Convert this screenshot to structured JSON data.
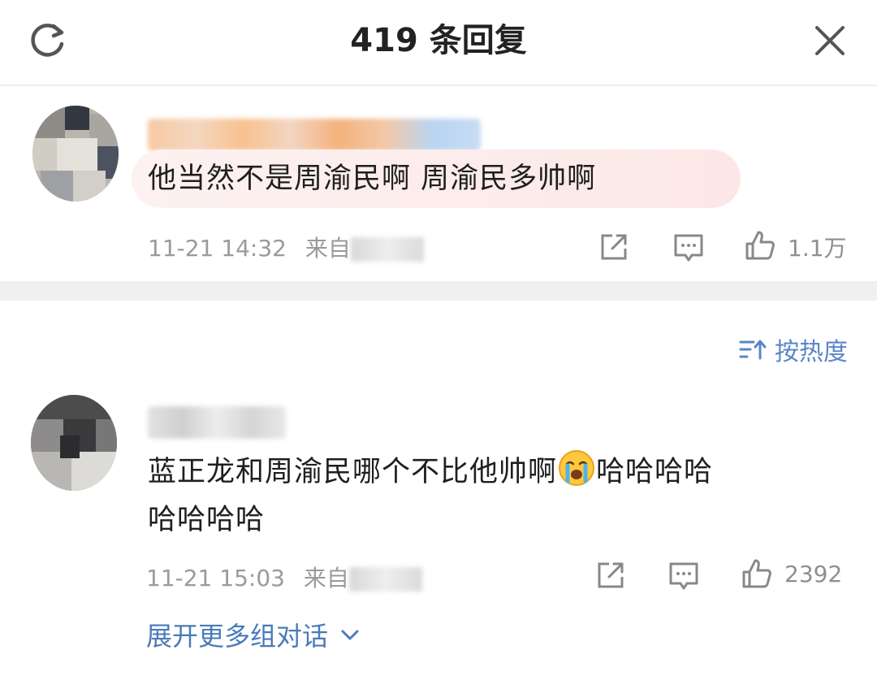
{
  "header": {
    "title": "419 条回复",
    "refresh_icon": "refresh-icon",
    "close_icon": "close-icon"
  },
  "main_comment": {
    "text": "他当然不是周渝民啊 周渝民多帅啊",
    "time": "11-21 14:32",
    "source_prefix": "来自",
    "likes": "1.1万"
  },
  "sort": {
    "label": "按热度",
    "icon": "sort-icon"
  },
  "reply": {
    "text_line1": "蓝正龙和周渝民哪个不比他帅啊",
    "text_line1_suffix": "哈哈哈哈",
    "text_line2": "哈哈哈哈",
    "emoji": "crying-emoji",
    "time": "11-21 15:03",
    "source_prefix": "来自",
    "likes": "2392"
  },
  "expand": {
    "label": "展开更多组对话"
  },
  "colors": {
    "accent": "#4a7ab9",
    "meta": "#9a9a9a",
    "divider": "#f0f0f0",
    "bubble": "#fbe7e6"
  }
}
